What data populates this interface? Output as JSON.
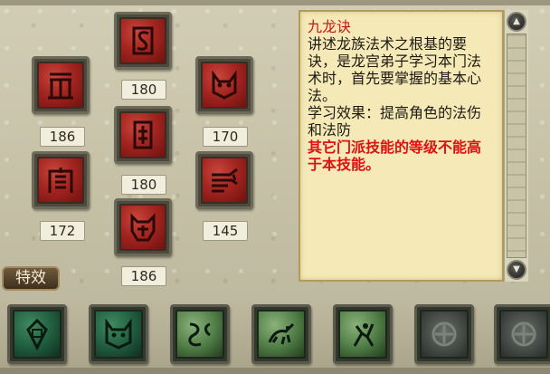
{
  "skills": [
    {
      "name": "skill-top-center",
      "level": null
    },
    {
      "name": "skill-left-upper",
      "level": "186"
    },
    {
      "name": "skill-center-upper",
      "level": "180"
    },
    {
      "name": "skill-right-upper",
      "level": "170"
    },
    {
      "name": "skill-left-lower",
      "level": "172"
    },
    {
      "name": "skill-center-lower",
      "level": "180"
    },
    {
      "name": "skill-right-lower",
      "level": "145"
    },
    {
      "name": "skill-bottom-center",
      "level": "186"
    }
  ],
  "top_center_level": "180",
  "description": {
    "title": "九龙诀",
    "body": "讲述龙族法术之根基的要诀，是龙宫弟子学习本门法术时，首先要掌握的基本心法。",
    "effect": "学习效果：提高角色的法伤和法防",
    "warning": "其它门派技能的等级不能高于本技能。"
  },
  "effects_button": "特效",
  "colors": {
    "title_red": "#c21a14",
    "warning_red": "#e01010",
    "panel_bg": "#f5e9b8",
    "skill_red": "#a42520"
  },
  "bottom_slots": [
    {
      "icon": "green-gem-icon",
      "style": "green"
    },
    {
      "icon": "green-dragon-head-icon",
      "style": "green"
    },
    {
      "icon": "green-serpent-icon",
      "style": "lime"
    },
    {
      "icon": "green-beast-icon",
      "style": "lime"
    },
    {
      "icon": "green-warrior-icon",
      "style": "lime"
    },
    {
      "icon": "empty-slot-icon",
      "style": "empty"
    },
    {
      "icon": "empty-slot-icon",
      "style": "empty"
    }
  ]
}
